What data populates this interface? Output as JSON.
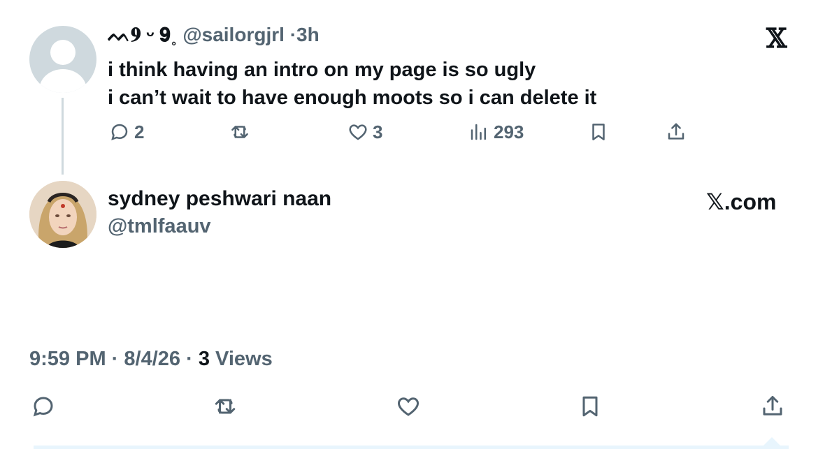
{
  "quoted_tweet": {
    "display_name": "ᨓ𝟗 ᵕ 𝟗˳",
    "handle": "@sailorgjrl",
    "separator": "·",
    "time": "3h",
    "text_lines": [
      "i think having an intro on my page is so ugly",
      "i can’t wait to have enough moots so i can delete it"
    ],
    "actions": {
      "replies": "2",
      "reposts": "",
      "likes": "3",
      "views": "293"
    }
  },
  "reply": {
    "display_name": "sydney peshwari naan",
    "handle": "@tmlfaauv",
    "site_label": "𝕏.com",
    "text": "",
    "time": "9:59 PM",
    "date": "8/4/26",
    "views_count": "3",
    "views_label": "Views",
    "separator": "·"
  },
  "brand": {
    "logo": "𝕏"
  },
  "colors": {
    "text_primary": "#0f1419",
    "text_secondary": "#536471",
    "thread_line": "#cfd9de"
  },
  "icons": [
    "reply-icon",
    "repost-icon",
    "like-icon",
    "views-icon",
    "bookmark-icon",
    "share-icon"
  ]
}
